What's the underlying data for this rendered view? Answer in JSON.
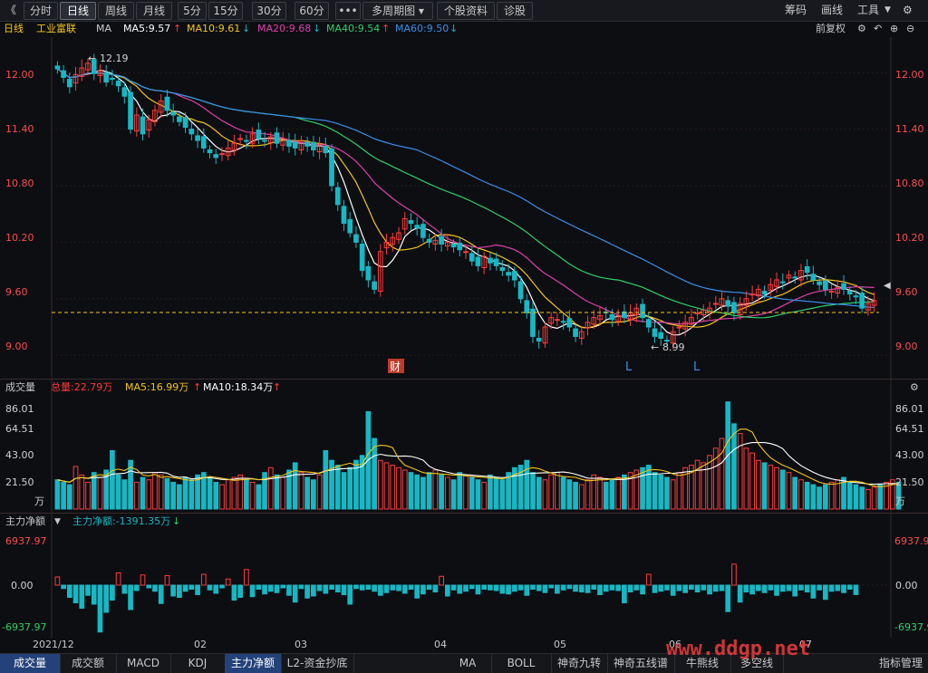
{
  "toolbar": {
    "back": "《",
    "tabs": [
      "分时",
      "日线",
      "周线",
      "月线",
      "5分",
      "15分",
      "30分",
      "60分"
    ],
    "more": "•••",
    "multi_period": "多周期图",
    "stock_info": "个股资料",
    "diagnose": "诊股",
    "right": [
      "筹码",
      "画线",
      "工具"
    ]
  },
  "info": {
    "period": "日线",
    "stock_name": "工业富联",
    "ma_label": "MA",
    "ma5": "MA5:9.57",
    "ma10": "MA10:9.61",
    "ma20": "MA20:9.68",
    "ma40": "MA40:9.54",
    "ma60": "MA60:9.50",
    "adjust": "前复权"
  },
  "main": {
    "y_ticks": [
      "12.00",
      "11.40",
      "10.80",
      "10.20",
      "9.60",
      "9.00"
    ],
    "high_label": "12.19",
    "low_label": "8.99",
    "fin_marker": "财",
    "l_markers": [
      "L",
      "L"
    ]
  },
  "volume": {
    "title": "成交量",
    "total": "总量:22.79万",
    "ma5": "MA5:16.99万",
    "ma10": "MA10:18.34万",
    "y_ticks": [
      "86.01",
      "64.51",
      "43.00",
      "21.50"
    ],
    "unit": "万"
  },
  "fund": {
    "title": "主力净额",
    "value": "主力净额:-1391.35万",
    "y_ticks": [
      "6937.97",
      "0.00",
      "-6937.97"
    ]
  },
  "x_labels": [
    "2021/12",
    "02",
    "03",
    "04",
    "05",
    "06",
    "07"
  ],
  "bottom_tabs": [
    "成交量",
    "成交额",
    "MACD",
    "KDJ",
    "主力净额",
    "L2-资金抄底",
    "MA",
    "BOLL",
    "神奇九转",
    "神奇五线谱",
    "牛熊线",
    "多空线"
  ],
  "bottom_right": "指标管理",
  "watermark": "www.ddgp.net",
  "colors": {
    "up": "#ff3b3b",
    "down": "#17b8c4",
    "ma5": "#ffffff",
    "ma10": "#f5c518",
    "ma20": "#e040a8",
    "ma40": "#2fd06a",
    "ma60": "#3a8fe8",
    "bg": "#0c0e12"
  },
  "chart_data": [
    {
      "type": "candlestick",
      "title": "工业富联 日线",
      "yticks": [
        12.0,
        11.4,
        10.8,
        10.2,
        9.6,
        9.0
      ],
      "ylim": [
        8.8,
        12.3
      ],
      "x_labels": [
        "2021/12",
        "02",
        "03",
        "04",
        "05",
        "06",
        "07"
      ],
      "close": [
        12.04,
        11.95,
        11.85,
        11.98,
        12.05,
        12.1,
        11.99,
        12.02,
        11.9,
        11.93,
        11.86,
        11.75,
        11.4,
        11.55,
        11.35,
        11.5,
        11.6,
        11.7,
        11.6,
        11.55,
        11.48,
        11.42,
        11.35,
        11.28,
        11.2,
        11.15,
        11.1,
        11.14,
        11.2,
        11.25,
        11.3,
        11.27,
        11.35,
        11.3,
        11.28,
        11.32,
        11.25,
        11.3,
        11.22,
        11.2,
        11.28,
        11.22,
        11.18,
        11.24,
        11.15,
        10.8,
        10.6,
        10.4,
        10.3,
        10.2,
        9.9,
        9.8,
        9.7,
        10.1,
        10.2,
        10.25,
        10.3,
        10.45,
        10.4,
        10.35,
        10.25,
        10.2,
        10.22,
        10.18,
        10.2,
        10.15,
        10.12,
        10.1,
        10.0,
        9.95,
        10.05,
        9.98,
        9.95,
        9.9,
        9.85,
        9.8,
        9.6,
        9.45,
        9.2,
        9.15,
        9.3,
        9.4,
        9.38,
        9.35,
        9.3,
        9.2,
        9.25,
        9.35,
        9.4,
        9.42,
        9.45,
        9.38,
        9.42,
        9.4,
        9.45,
        9.5,
        9.4,
        9.3,
        9.2,
        9.18,
        9.15,
        9.25,
        9.3,
        9.35,
        9.4,
        9.45,
        9.48,
        9.5,
        9.55,
        9.6,
        9.52,
        9.45,
        9.55,
        9.6,
        9.65,
        9.7,
        9.65,
        9.75,
        9.8,
        9.78,
        9.85,
        9.82,
        9.9,
        9.88,
        9.8,
        9.75,
        9.7,
        9.68,
        9.72,
        9.7,
        9.65,
        9.62,
        9.5,
        9.55,
        9.58
      ],
      "ma5": [
        9.57
      ],
      "ma10": [
        9.61
      ],
      "ma20": [
        9.68
      ],
      "ma40": [
        9.54
      ],
      "ma60": [
        9.5
      ],
      "annotations": [
        "12.19",
        "8.99"
      ]
    },
    {
      "type": "bar",
      "title": "成交量",
      "yticks": [
        86.01,
        64.51,
        43.0,
        21.5
      ],
      "ylim": [
        0,
        90
      ],
      "unit": "万",
      "values": [
        24,
        22,
        20,
        35,
        28,
        22,
        30,
        26,
        32,
        48,
        28,
        24,
        40,
        22,
        26,
        24,
        30,
        28,
        25,
        22,
        20,
        26,
        24,
        28,
        30,
        26,
        22,
        20,
        24,
        26,
        28,
        24,
        22,
        20,
        30,
        34,
        28,
        26,
        32,
        38,
        30,
        26,
        24,
        28,
        48,
        40,
        36,
        30,
        34,
        40,
        44,
        80,
        58,
        40,
        38,
        36,
        34,
        32,
        30,
        28,
        26,
        30,
        32,
        28,
        26,
        24,
        30,
        28,
        26,
        24,
        22,
        28,
        26,
        24,
        30,
        34,
        36,
        40,
        30,
        26,
        24,
        28,
        30,
        26,
        24,
        22,
        20,
        24,
        28,
        26,
        22,
        24,
        26,
        28,
        30,
        32,
        34,
        36,
        30,
        28,
        26,
        24,
        30,
        34,
        36,
        40,
        38,
        44,
        50,
        58,
        88,
        70,
        62,
        50,
        46,
        40,
        38,
        36,
        34,
        32,
        30,
        26,
        24,
        22,
        20,
        18,
        20,
        22,
        24,
        26,
        22,
        20,
        18,
        16,
        18,
        20,
        22,
        24,
        22
      ],
      "ma5": [
        16.99
      ],
      "ma10": [
        18.34
      ]
    },
    {
      "type": "bar",
      "title": "主力净额",
      "yticks": [
        6937.97,
        0.0,
        -6937.97
      ],
      "ylim": [
        -6937.97,
        6937.97
      ],
      "unit": "万",
      "values": [
        1200,
        -500,
        -1800,
        -2600,
        -3400,
        -1500,
        -2800,
        -6900,
        -4000,
        -2200,
        1800,
        -1200,
        -3600,
        -800,
        1500,
        -400,
        -900,
        -2700,
        1400,
        -1600,
        -1800,
        -900,
        -600,
        -1400,
        1600,
        -700,
        -1200,
        -400,
        900,
        -2200,
        -1800,
        2300,
        -1700,
        -600,
        -1300,
        -900,
        -1100,
        -400,
        -1500,
        -2500,
        -500,
        -1900,
        -1600,
        -800,
        -1200,
        -600,
        -1000,
        -1400,
        -2800,
        -500,
        -700,
        -600,
        -900,
        -1500,
        -1100,
        -700,
        -800,
        -1200,
        -600,
        -1900,
        -1300,
        -600,
        -1000,
        1300,
        -1600,
        -700,
        -1200,
        -900,
        -500,
        -1300,
        -600,
        -700,
        -800,
        -1200,
        -1300,
        -900,
        -700,
        -1500,
        -600,
        -800,
        -1100,
        -400,
        -1200,
        -700,
        -500,
        -900,
        -1000,
        -1100,
        -600,
        -1400,
        -900,
        -700,
        -800,
        -2600,
        -1000,
        -700,
        -1300,
        1600,
        -1100,
        -900,
        -700,
        -1500,
        -800,
        -1100,
        -600,
        -1000,
        -700,
        -1300,
        -900,
        -800,
        -3900,
        3100,
        -2500,
        -1000,
        -1300,
        -800,
        -1100,
        -700,
        -1500,
        -900,
        -800,
        -1600,
        -700,
        -1000,
        -1900,
        -700,
        -2100,
        -900,
        -800,
        -1100,
        -600,
        -1391.35
      ],
      "value_label": "-1391.35万"
    }
  ]
}
